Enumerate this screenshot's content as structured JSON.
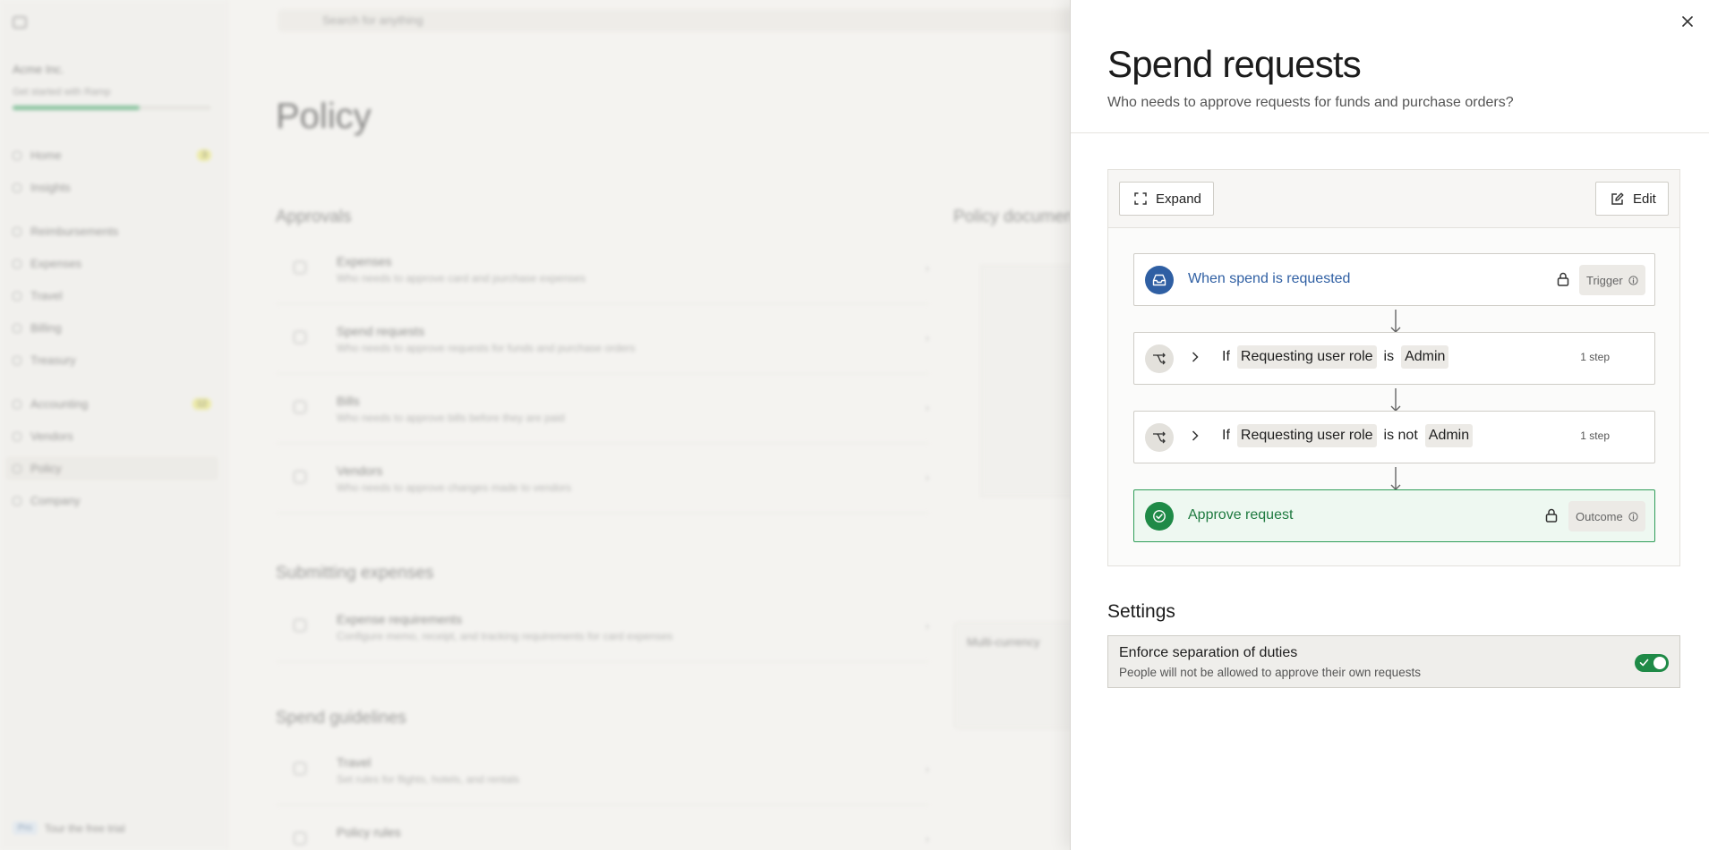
{
  "background": {
    "search_placeholder": "Search for anything",
    "page_title": "Policy",
    "sidebar": {
      "org_name": "Acme Inc.",
      "setup_text": "Get started with Ramp",
      "setup_progress": 0.64,
      "items": [
        {
          "label": "Home",
          "badge": "3"
        },
        {
          "label": "Insights",
          "badge": ""
        },
        {
          "label": "Reimbursements",
          "badge": ""
        },
        {
          "label": "Expenses",
          "badge": ""
        },
        {
          "label": "Travel",
          "badge": ""
        },
        {
          "label": "Billing",
          "badge": ""
        },
        {
          "label": "Treasury",
          "badge": ""
        },
        {
          "label": "Accounting",
          "badge": "12"
        },
        {
          "label": "Vendors",
          "badge": ""
        },
        {
          "label": "Policy",
          "badge": ""
        },
        {
          "label": "Company",
          "badge": ""
        }
      ],
      "bottom_pill": "Pro",
      "bottom_text": "Tour the free trial"
    },
    "sections": {
      "approvals": "Approvals",
      "submitting": "Submitting expenses",
      "guidelines": "Spend guidelines",
      "policy_doc": "Policy document"
    },
    "rows": [
      {
        "title": "Expenses",
        "desc": "Who needs to approve card and purchase expenses"
      },
      {
        "title": "Spend requests",
        "desc": "Who needs to approve requests for funds and purchase orders"
      },
      {
        "title": "Bills",
        "desc": "Who needs to approve bills before they are paid"
      },
      {
        "title": "Vendors",
        "desc": "Who needs to approve changes made to vendors"
      },
      {
        "title": "Expense requirements",
        "desc": "Configure memo, receipt, and tracking requirements for card expenses"
      },
      {
        "title": "Travel",
        "desc": "Set rules for flights, hotels, and rentals"
      },
      {
        "title": "Policy rules",
        "desc": ""
      }
    ],
    "card_title": "Multi-currency"
  },
  "drawer": {
    "title": "Spend requests",
    "subtitle": "Who needs to approve requests for funds and purchase orders?",
    "toolbar": {
      "expand_label": "Expand",
      "edit_label": "Edit"
    },
    "flow": {
      "trigger": {
        "title": "When spend is requested",
        "tag": "Trigger"
      },
      "conditions": [
        {
          "keyword": "If",
          "field": "Requesting user role",
          "operator": "is",
          "value": "Admin",
          "steps": "1 step"
        },
        {
          "keyword": "If",
          "field": "Requesting user role",
          "operator": "is not",
          "value": "Admin",
          "steps": "1 step"
        }
      ],
      "outcome": {
        "title": "Approve request",
        "tag": "Outcome"
      }
    },
    "settings": {
      "heading": "Settings",
      "separation": {
        "title": "Enforce separation of duties",
        "description": "People will not be allowed to approve their own requests",
        "enabled": true
      }
    }
  },
  "colors": {
    "trigger_blue": "#2f5fa3",
    "outcome_green": "#1f8a47",
    "toggle_on": "#1f8a47"
  }
}
